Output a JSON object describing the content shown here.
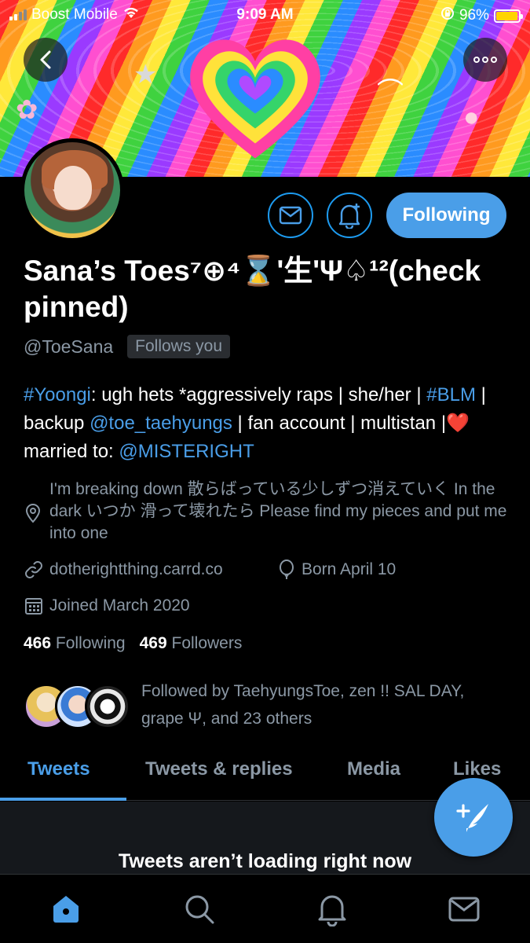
{
  "status_bar": {
    "carrier": "Boost Mobile",
    "time": "9:09 AM",
    "battery": "96%",
    "battery_level": 0.96
  },
  "profile": {
    "display_name": "Sana’s Toes⁷⊕⁴⌛'生'Ψ♤¹²(check pinned)",
    "handle": "@ToeSana",
    "follows_you": "Follows you",
    "follow_button": "Following",
    "bio": {
      "part1_link": "#Yoongi",
      "part1_text": ": ugh hets *aggressively raps | she/her | ",
      "part2_link": "#BLM",
      "part2_text": " | backup ",
      "part3_link": "@toe_taehyungs",
      "part3_text": " | fan account | multistan |",
      "heart": "❤️",
      "part4_text": "married to: ",
      "part4_link": "@MISTERIGHT"
    },
    "location": "I'm breaking down 散らばっている少しずつ消えていく In the dark いつか 滑って壊れたら Please find my pieces and put me into one",
    "website": "dotherightthing.carrd.co",
    "birthday": "Born April 10",
    "joined": "Joined March 2020",
    "following_count": "466",
    "following_label": "Following",
    "followers_count": "469",
    "followers_label": "Followers",
    "followed_by": "Followed by TaehyungsToe, zen !! SAL DAY, grape Ψ, and 23 others"
  },
  "tabs": [
    {
      "label": "Tweets",
      "active": true
    },
    {
      "label": "Tweets & replies",
      "active": false
    },
    {
      "label": "Media",
      "active": false
    },
    {
      "label": "Likes",
      "active": false
    }
  ],
  "feed": {
    "message": "Tweets aren’t loading right now"
  },
  "bottom_nav": [
    "home-icon",
    "search-icon",
    "notifications-icon",
    "messages-icon"
  ],
  "colors": {
    "accent": "#4a9ee8",
    "background": "#000000",
    "muted_text": "#8b98a5"
  }
}
